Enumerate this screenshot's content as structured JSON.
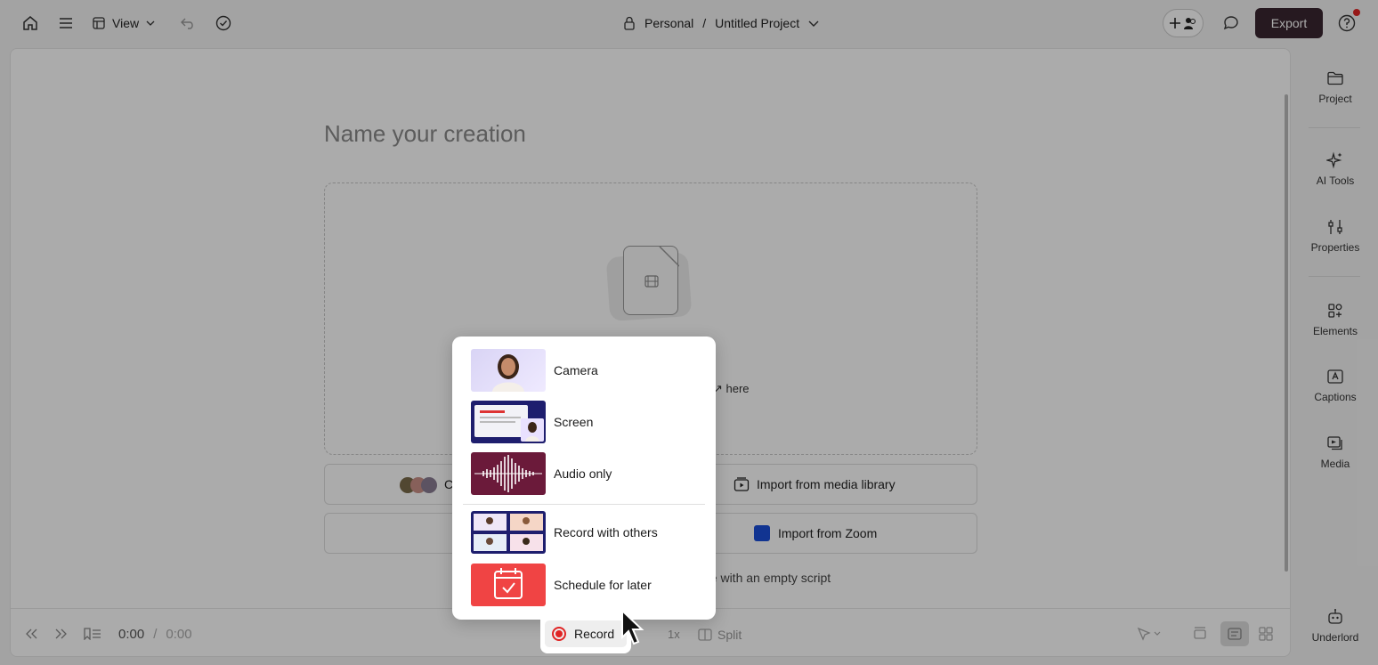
{
  "topbar": {
    "view_label": "View",
    "workspace": "Personal",
    "separator": "/",
    "project_title": "Untitled Project",
    "export_label": "Export"
  },
  "canvas": {
    "title_placeholder": "Name your creation",
    "drop_hint_suffix": "here",
    "buttons": {
      "create_prefix": "Cr",
      "import_media": "Import from media library",
      "import_zoom": "Import from Zoom"
    },
    "empty_script_partial": "ue with an empty script"
  },
  "bottombar": {
    "time_current": "0:00",
    "time_sep": "/",
    "time_total": "0:00",
    "speed": "1x",
    "split_label": "Split"
  },
  "sidebar": {
    "items": [
      {
        "label": "Project",
        "icon": "folder-icon"
      },
      {
        "label": "AI Tools",
        "icon": "sparkle-icon"
      },
      {
        "label": "Properties",
        "icon": "sliders-icon"
      },
      {
        "label": "Elements",
        "icon": "shapes-icon"
      },
      {
        "label": "Captions",
        "icon": "captions-icon"
      },
      {
        "label": "Media",
        "icon": "media-icon"
      },
      {
        "label": "Underlord",
        "icon": "robot-icon"
      }
    ]
  },
  "record_menu": {
    "items": [
      {
        "label": "Camera"
      },
      {
        "label": "Screen"
      },
      {
        "label": "Audio only"
      },
      {
        "label": "Record with others"
      },
      {
        "label": "Schedule for later"
      }
    ]
  },
  "record_button": {
    "label": "Record"
  },
  "colors": {
    "accent_dark": "#3a2630",
    "record_red": "#e02424",
    "audio_thumb": "#6b1a3a",
    "screen_thumb": "#1e1e6e",
    "schedule_thumb": "#f04444"
  }
}
